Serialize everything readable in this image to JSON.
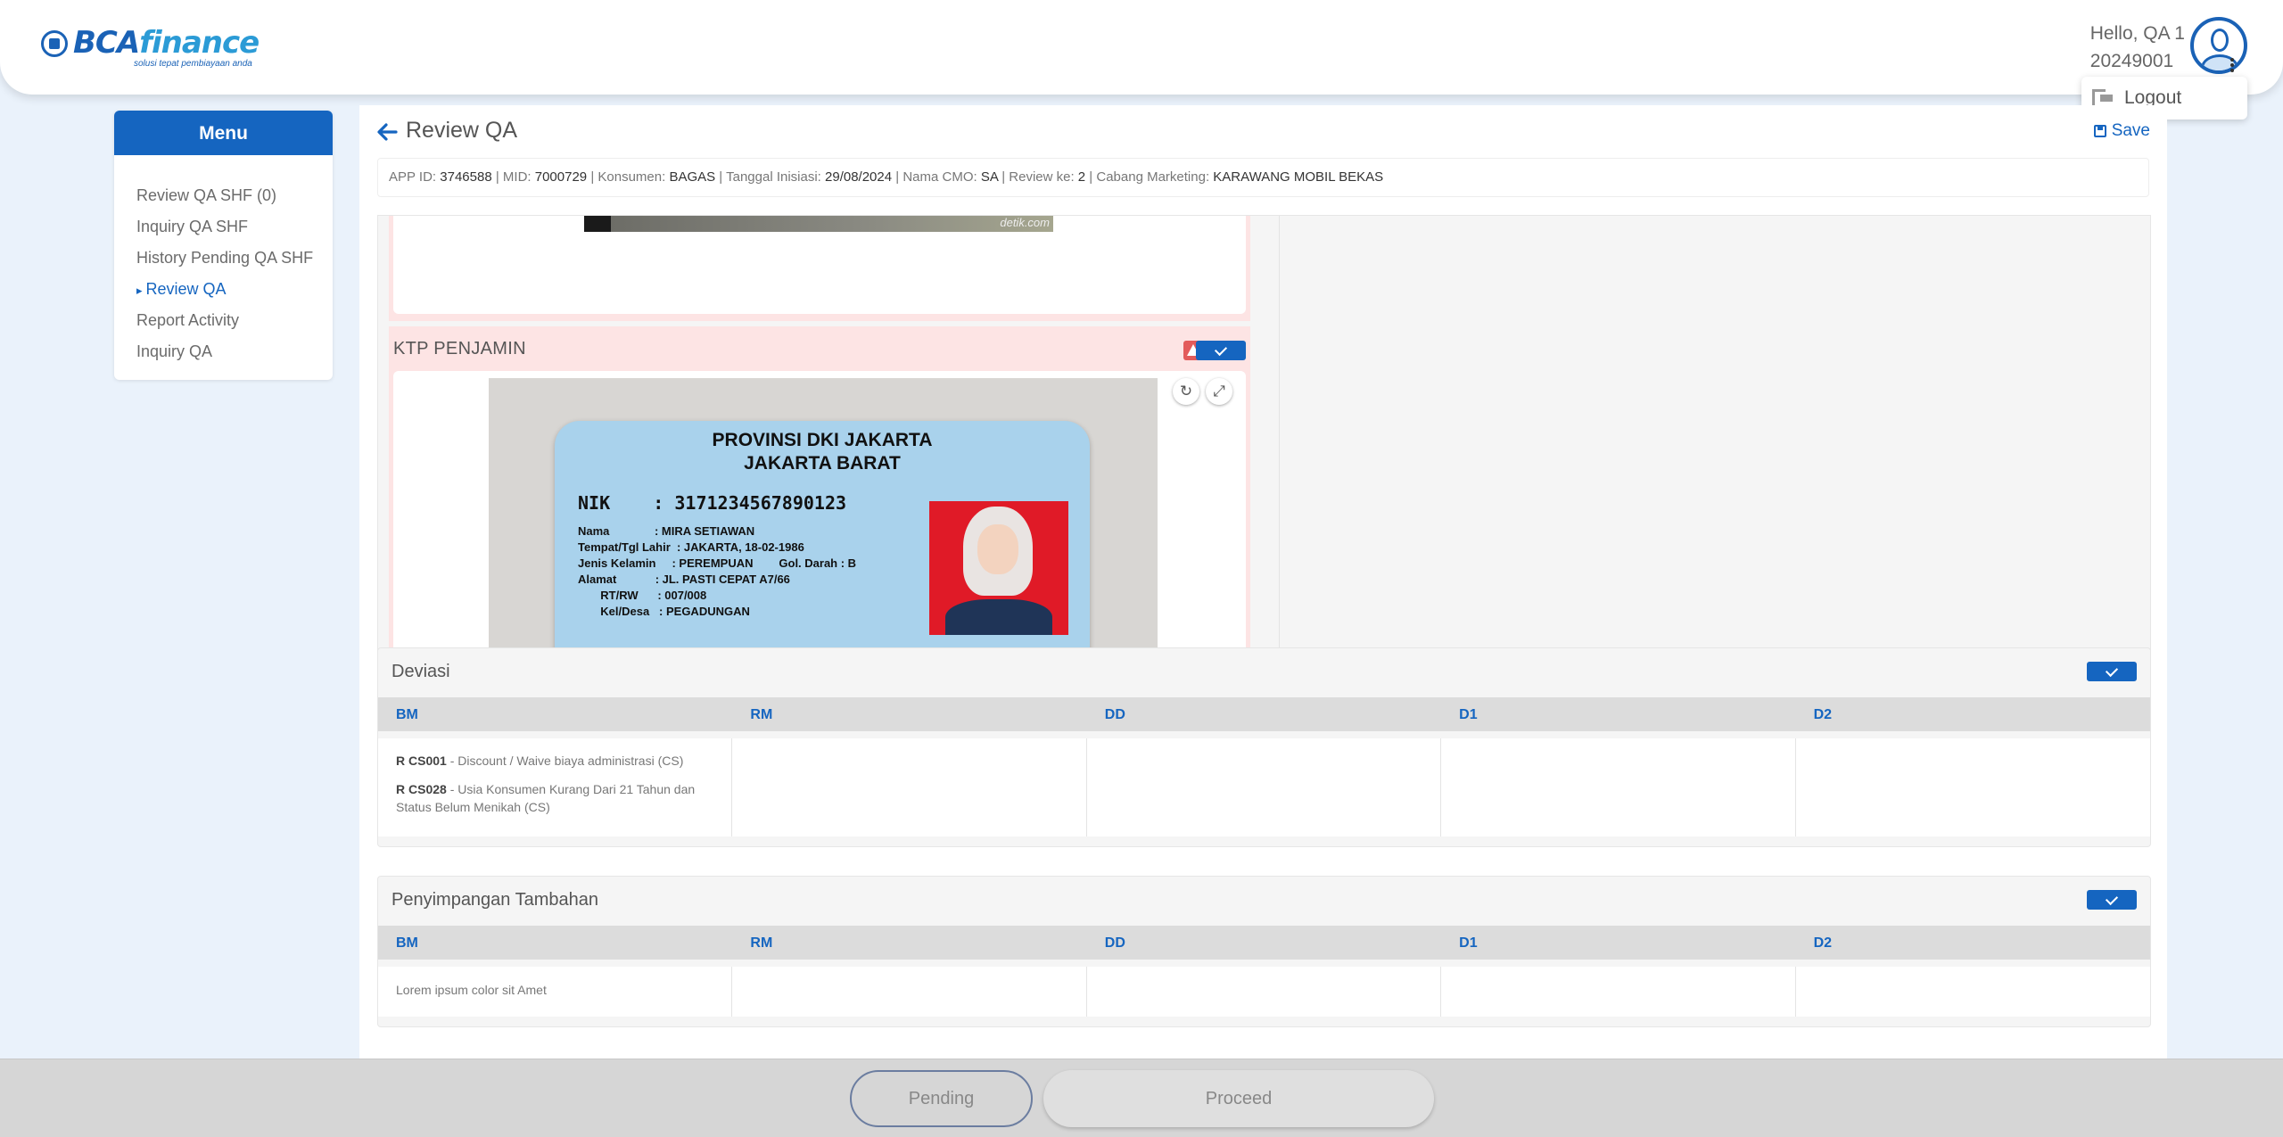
{
  "header": {
    "logo_brand_a": "BCA",
    "logo_brand_b": "finance",
    "logo_tagline": "solusi tepat pembiayaan anda",
    "greeting": "Hello, QA 1",
    "user_id": "20249001",
    "logout_label": "Logout"
  },
  "sidebar": {
    "title": "Menu",
    "items": [
      {
        "label": "Review QA SHF (0)",
        "active": false
      },
      {
        "label": "Inquiry QA SHF",
        "active": false
      },
      {
        "label": "History Pending QA SHF",
        "active": false
      },
      {
        "label": "Review QA",
        "active": true
      },
      {
        "label": "Report Activity",
        "active": false
      },
      {
        "label": "Inquiry QA",
        "active": false
      }
    ]
  },
  "main": {
    "title": "Review QA",
    "save_label": "Save",
    "info": {
      "app_id_label": "APP ID:",
      "app_id": "3746588",
      "mid_label": "MID:",
      "mid": "7000729",
      "konsumen_label": "Konsumen:",
      "konsumen": "BAGAS",
      "tanggal_label": "Tanggal Inisiasi:",
      "tanggal": "29/08/2024",
      "cmo_label": "Nama CMO:",
      "cmo": "SA",
      "review_label": "Review ke:",
      "review": "2",
      "cabang_label": "Cabang Marketing:",
      "cabang": "KARAWANG MOBIL BEKAS"
    },
    "prev_image_watermark": "detik.com",
    "ktp_section_title": "KTP PENJAMIN",
    "ktp": {
      "province": "PROVINSI DKI JAKARTA",
      "city": "JAKARTA BARAT",
      "nik": "NIK    : 3171234567890123",
      "rows": [
        "Nama              : MIRA SETIAWAN",
        "Tempat/Tgl Lahir  : JAKARTA, 18-02-1986",
        "Jenis Kelamin     : PEREMPUAN        Gol. Darah : B",
        "Alamat            : JL. PASTI CEPAT A7/66",
        "       RT/RW      : 007/008",
        "       Kel/Desa   : PEGADUNGAN"
      ]
    }
  },
  "deviasi": {
    "title": "Deviasi",
    "columns": [
      "BM",
      "RM",
      "DD",
      "D1",
      "D2"
    ],
    "bm_items": [
      {
        "code": "R CS001",
        "desc": " - Discount / Waive biaya administrasi (CS)"
      },
      {
        "code": "R CS028",
        "desc": " - Usia Konsumen Kurang Dari 21 Tahun dan Status Belum Menikah (CS)"
      }
    ]
  },
  "penyimpangan": {
    "title": "Penyimpangan Tambahan",
    "columns": [
      "BM",
      "RM",
      "DD",
      "D1",
      "D2"
    ],
    "bm_text": "Lorem ipsum color sit Amet"
  },
  "footer": {
    "pending_label": "Pending",
    "proceed_label": "Proceed"
  },
  "colors": {
    "primary": "#1565c0",
    "warning": "#e35b5b",
    "panel_pink": "#fde4e4"
  }
}
